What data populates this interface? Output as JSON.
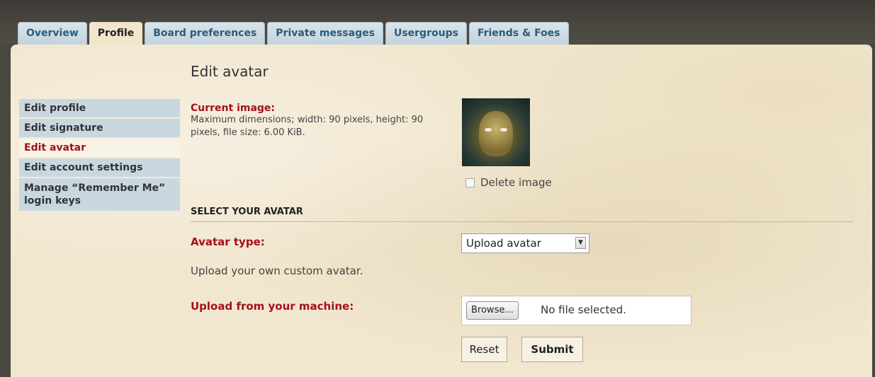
{
  "tabs": [
    {
      "label": "Overview"
    },
    {
      "label": "Profile"
    },
    {
      "label": "Board preferences"
    },
    {
      "label": "Private messages"
    },
    {
      "label": "Usergroups"
    },
    {
      "label": "Friends & Foes"
    }
  ],
  "sidebar": {
    "items": [
      {
        "label": "Edit profile"
      },
      {
        "label": "Edit signature"
      },
      {
        "label": "Edit avatar"
      },
      {
        "label": "Edit account settings"
      },
      {
        "label": "Manage “Remember Me” login keys"
      }
    ]
  },
  "main": {
    "title": "Edit avatar",
    "current_image_label": "Current image:",
    "current_image_help": "Maximum dimensions; width: 90 pixels, height: 90 pixels, file size: 6.00 KiB.",
    "delete_label": "Delete image",
    "section_heading": "SELECT YOUR AVATAR",
    "avatar_type_label": "Avatar type:",
    "avatar_type_value": "Upload avatar",
    "avatar_type_help": "Upload your own custom avatar.",
    "upload_label": "Upload from your machine:",
    "browse_label": "Browse...",
    "no_file_text": "No file selected.",
    "reset_label": "Reset",
    "submit_label": "Submit"
  },
  "colors": {
    "accent_red": "#a4111b",
    "tab_blue": "#2d5a7c",
    "panel_bg": "#f1e7cf",
    "nav_bg": "#c9d8e0"
  }
}
